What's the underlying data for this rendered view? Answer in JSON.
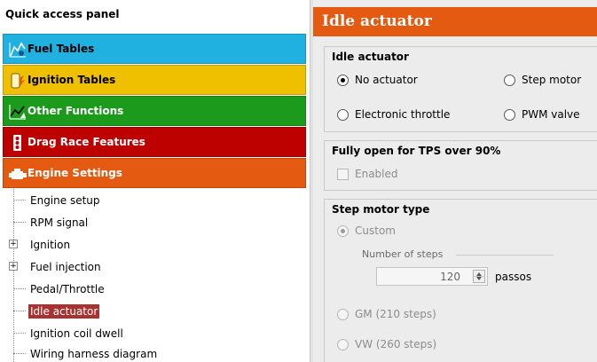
{
  "quick_access": {
    "title": "Quick access panel",
    "categories": [
      {
        "label": "Fuel Tables",
        "icon": "fuel-table-icon",
        "color": "#20b1e0"
      },
      {
        "label": "Ignition Tables",
        "icon": "ignition-table-icon",
        "color": "#efc000"
      },
      {
        "label": "Other Functions",
        "icon": "other-functions-icon",
        "color": "#1c9a1c"
      },
      {
        "label": "Drag Race Features",
        "icon": "drag-race-icon",
        "color": "#bd0000"
      },
      {
        "label": "Engine Settings",
        "icon": "engine-icon",
        "color": "#e35a10"
      }
    ],
    "tree": [
      {
        "label": "Engine setup"
      },
      {
        "label": "RPM signal"
      },
      {
        "label": "Ignition",
        "expand": "+"
      },
      {
        "label": "Fuel injection",
        "expand": "+"
      },
      {
        "label": "Pedal/Throttle"
      },
      {
        "label": "Idle actuator",
        "selected": true
      },
      {
        "label": "Ignition coil dwell"
      },
      {
        "label": "Wiring harness diagram"
      }
    ]
  },
  "panel": {
    "title": "Idle actuator",
    "accent": "#e35a10",
    "idle_group": {
      "title": "Idle actuator",
      "options": {
        "no_actuator": "No actuator",
        "step_motor": "Step motor",
        "electronic_throttle": "Electronic throttle",
        "pwm_valve": "PWM valve"
      },
      "selected": "No actuator"
    },
    "tps_group": {
      "title": "Fully open for TPS over 90%",
      "enabled_label": "Enabled",
      "enabled": false
    },
    "step_group": {
      "title": "Step motor type",
      "custom_label": "Custom",
      "steps_label": "Number of steps",
      "steps_value": "120",
      "steps_unit": "passos",
      "gm_label": "GM (210 steps)",
      "vw_label": "VW (260 steps)"
    }
  }
}
